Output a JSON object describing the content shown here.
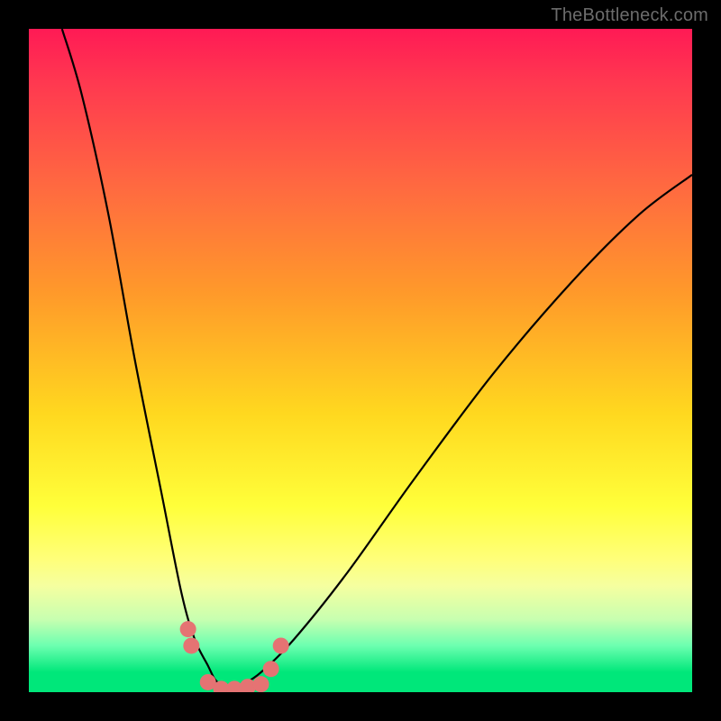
{
  "watermark": "TheBottleneck.com",
  "chart_data": {
    "type": "line",
    "title": "",
    "xlabel": "",
    "ylabel": "",
    "xlim": [
      0,
      100
    ],
    "ylim": [
      0,
      100
    ],
    "series": [
      {
        "name": "bottleneck-curve-left",
        "x": [
          5,
          8,
          12,
          16,
          20,
          23,
          25,
          27,
          28,
          29,
          30
        ],
        "y": [
          100,
          90,
          72,
          50,
          30,
          15,
          8,
          4,
          2,
          1,
          0
        ]
      },
      {
        "name": "bottleneck-curve-right",
        "x": [
          30,
          32,
          35,
          40,
          48,
          58,
          70,
          82,
          92,
          100
        ],
        "y": [
          0,
          1,
          3,
          8,
          18,
          32,
          48,
          62,
          72,
          78
        ]
      }
    ],
    "bottom_markers": {
      "name": "data-points",
      "color": "#e57373",
      "points": [
        {
          "x": 24.0,
          "y": 9.5
        },
        {
          "x": 24.5,
          "y": 7.0
        },
        {
          "x": 27.0,
          "y": 1.5
        },
        {
          "x": 29.0,
          "y": 0.5
        },
        {
          "x": 31.0,
          "y": 0.5
        },
        {
          "x": 33.0,
          "y": 0.8
        },
        {
          "x": 35.0,
          "y": 1.2
        },
        {
          "x": 36.5,
          "y": 3.5
        },
        {
          "x": 38.0,
          "y": 7.0
        }
      ]
    },
    "gradient_meaning": "top red = high bottleneck, bottom green = low bottleneck"
  }
}
